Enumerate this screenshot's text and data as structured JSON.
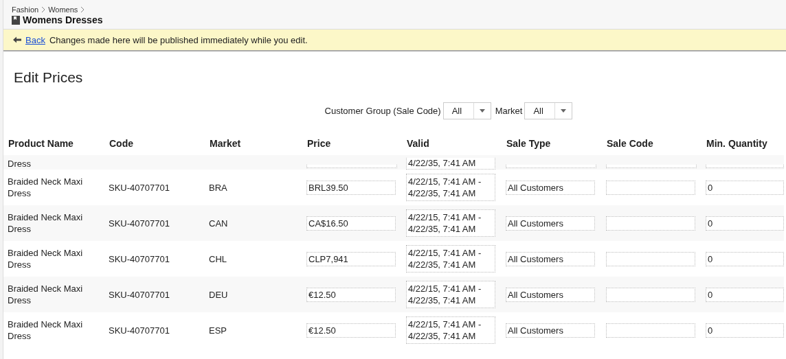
{
  "breadcrumb": [
    "Fashion",
    "Womens"
  ],
  "page_title": "Womens Dresses",
  "notice": {
    "link": "Back",
    "message": "Changes made here will be published immediately while you edit."
  },
  "heading": "Edit Prices",
  "filters": [
    {
      "label": "Customer Group (Sale Code)",
      "value": "All"
    },
    {
      "label": "Market",
      "value": "All"
    }
  ],
  "table": {
    "columns": [
      "Product Name",
      "Code",
      "Market",
      "Price",
      "Valid",
      "Sale Type",
      "Sale Code",
      "Min. Quantity"
    ],
    "partial_row": {
      "product": "Dress",
      "valid": "4/22/35, 7:41 AM"
    },
    "rows": [
      {
        "product": "Braided Neck Maxi Dress",
        "code": "SKU-40707701",
        "market": "BRA",
        "price": "BRL39.50",
        "valid": "4/22/15, 7:41 AM - 4/22/35, 7:41 AM",
        "sale_type": "All Customers",
        "min_quantity": "0"
      },
      {
        "product": "Braided Neck Maxi Dress",
        "code": "SKU-40707701",
        "market": "CAN",
        "price": "CA$16.50",
        "valid": "4/22/15, 7:41 AM - 4/22/35, 7:41 AM",
        "sale_type": "All Customers",
        "min_quantity": "0"
      },
      {
        "product": "Braided Neck Maxi Dress",
        "code": "SKU-40707701",
        "market": "CHL",
        "price": "CLP7,941",
        "valid": "4/22/15, 7:41 AM - 4/22/35, 7:41 AM",
        "sale_type": "All Customers",
        "min_quantity": "0"
      },
      {
        "product": "Braided Neck Maxi Dress",
        "code": "SKU-40707701",
        "market": "DEU",
        "price": "€12.50",
        "valid": "4/22/15, 7:41 AM - 4/22/35, 7:41 AM",
        "sale_type": "All Customers",
        "min_quantity": "0"
      },
      {
        "product": "Braided Neck Maxi Dress",
        "code": "SKU-40707701",
        "market": "ESP",
        "price": "€12.50",
        "valid": "4/22/15, 7:41 AM - 4/22/35, 7:41 AM",
        "sale_type": "All Customers",
        "min_quantity": "0"
      }
    ]
  }
}
